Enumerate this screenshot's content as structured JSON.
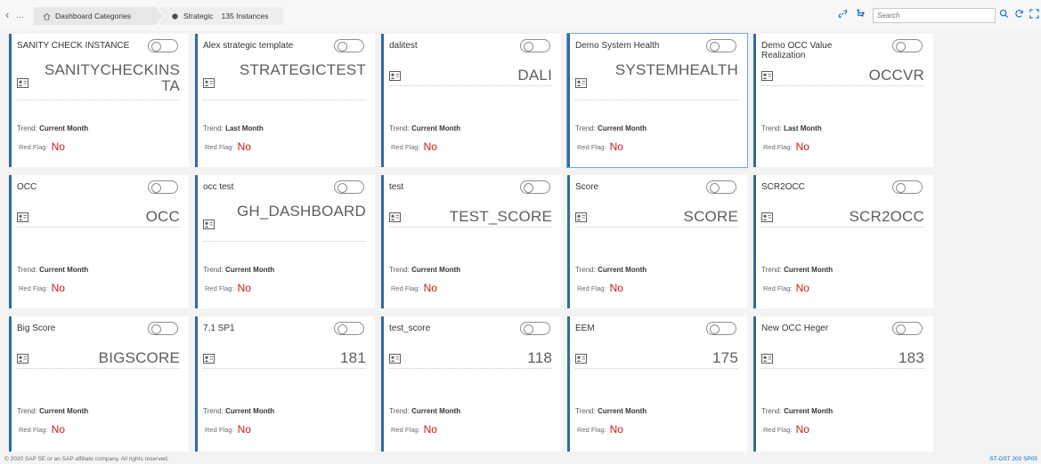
{
  "breadcrumb": {
    "back_icon": "chevron-left-icon",
    "item1_label": "Dashboard Categories",
    "item2_label": "Strategic",
    "item2_count": "135 Instances"
  },
  "toolbar": {
    "search_placeholder": "Search"
  },
  "tiles": [
    {
      "title": "SANITY CHECK INSTANCE",
      "kpi": "SANITYCHECKINSTA",
      "trend": "Current Month",
      "red_flag": "No"
    },
    {
      "title": "Alex strategic template",
      "kpi": "STRATEGICTEST",
      "trend": "Last Month",
      "red_flag": "No"
    },
    {
      "title": "dalitest",
      "kpi": "DALI",
      "trend": "Current Month",
      "red_flag": "No"
    },
    {
      "title": "Demo System Health",
      "kpi": "SYSTEMHEALTH",
      "trend": "Current Month",
      "red_flag": "No"
    },
    {
      "title": "Demo OCC Value Realization",
      "kpi": "OCCVR",
      "trend": "Last Month",
      "red_flag": "No"
    },
    {
      "title": "OCC",
      "kpi": "OCC",
      "trend": "Current Month",
      "red_flag": "No"
    },
    {
      "title": "occ test",
      "kpi": "GH_DASHBOARD",
      "trend": "Current Month",
      "red_flag": "No"
    },
    {
      "title": "test",
      "kpi": "TEST_SCORE",
      "trend": "Current Month",
      "red_flag": "No"
    },
    {
      "title": "Score",
      "kpi": "SCORE",
      "trend": "Current Month",
      "red_flag": "No"
    },
    {
      "title": "SCR2OCC",
      "kpi": "SCR2OCC",
      "trend": "Current Month",
      "red_flag": "No"
    },
    {
      "title": "Big Score",
      "kpi": "BIGSCORE",
      "trend": "Current Month",
      "red_flag": "No"
    },
    {
      "title": "7.1 SP1",
      "kpi": "181",
      "trend": "Current Month",
      "red_flag": "No"
    },
    {
      "title": "test_score",
      "kpi": "118",
      "trend": "Current Month",
      "red_flag": "No"
    },
    {
      "title": "EEM",
      "kpi": "175",
      "trend": "Current Month",
      "red_flag": "No"
    },
    {
      "title": "New OCC Heger",
      "kpi": "183",
      "trend": "Current Month",
      "red_flag": "No"
    }
  ],
  "labels": {
    "trend_prefix": "Trend:",
    "red_flag_prefix": "Red Flag:"
  },
  "footer": {
    "copyright": "© 2020 SAP SE or an SAP affiliate company. All rights reserved.",
    "version": "ST-OST 200 SP05"
  },
  "colors": {
    "tile_accent": "#2f6aa8",
    "red_flag": "#cc1919",
    "link": "#0a6ed1"
  }
}
